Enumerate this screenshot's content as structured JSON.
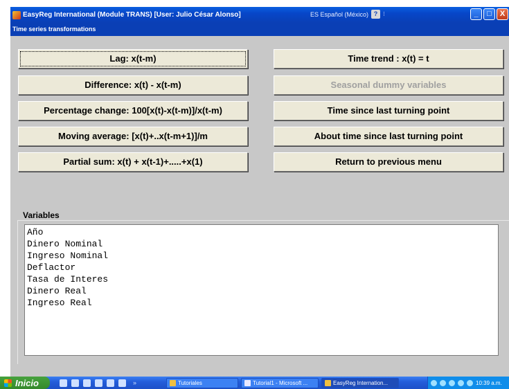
{
  "window": {
    "title": "EasyReg International (Module TRANS) [User: Julio César Alonso]",
    "language": "ES Español (México)",
    "help_glyph": "?",
    "lang_arrow": "⁝",
    "buttons": {
      "minimize": "_",
      "maximize": "□",
      "close": "X"
    }
  },
  "dialog": {
    "title": "Time series transformations"
  },
  "buttons_left": [
    "Lag:  x(t-m)",
    "Difference: x(t) - x(t-m)",
    "Percentage change: 100[x(t)-x(t-m)]/x(t-m)",
    "Moving average: [x(t)+..x(t-m+1)]/m",
    "Partial sum:  x(t) + x(t-1)+.....+x(1)"
  ],
  "buttons_right": [
    "Time trend :  x(t) = t",
    "Seasonal dummy variables",
    "Time since last turning point",
    "About time since last turning point",
    "Return to previous menu"
  ],
  "variables": {
    "label": "Variables",
    "items": [
      "Año",
      "Dinero Nominal",
      "Ingreso Nominal",
      "Deflactor",
      "Tasa de Interes",
      "Dinero Real",
      "Ingreso Real"
    ]
  },
  "taskbar": {
    "start_label": "Inicio",
    "chevron": "»",
    "tasks": [
      "Tutoriales",
      "Tutorial1 - Microsoft ...",
      "EasyReg Internation..."
    ],
    "clock": "10:39 a.m."
  },
  "colors": {
    "titlebar": "#0a3fb5",
    "panel": "#c8c8c8",
    "button_face": "#ece9d8",
    "disabled_text": "#a0a0a0",
    "taskbar": "#245edb",
    "start": "#3c9a32"
  }
}
